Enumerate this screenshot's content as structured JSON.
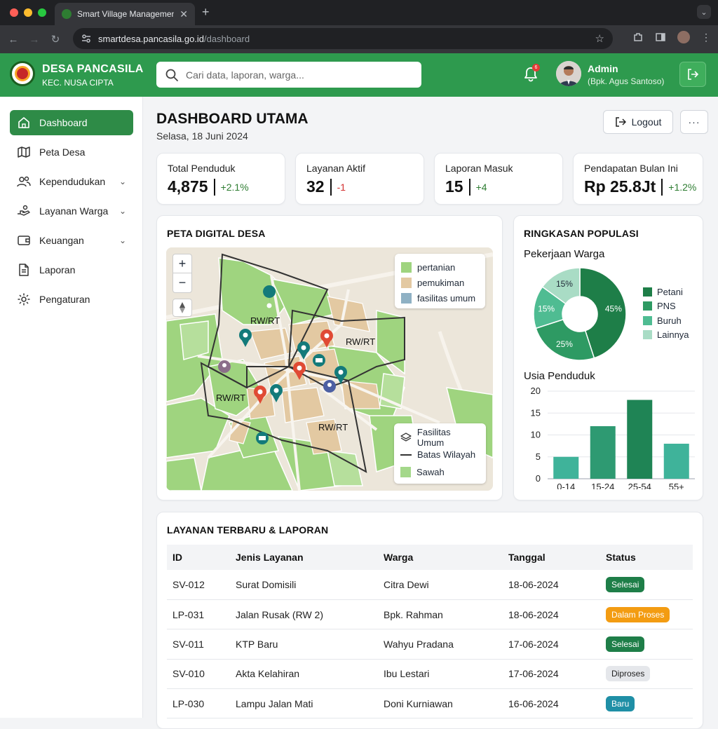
{
  "browser": {
    "tab_title": "Smart Village Management I",
    "url_host": "smartdesa.pancasila.go.id",
    "url_path": "/dashboard"
  },
  "header": {
    "brand_name": "DESA PANCASILA",
    "brand_sub": "KEC. NUSA CIPTA",
    "search_placeholder": "Cari data, laporan, warga...",
    "notif_count": "6",
    "user_name": "Admin",
    "user_role": "(Bpk. Agus Santoso)"
  },
  "sidebar": {
    "items": [
      {
        "label": "Dashboard",
        "icon": "home-icon",
        "active": true,
        "expandable": false
      },
      {
        "label": "Peta Desa",
        "icon": "map-icon",
        "active": false,
        "expandable": false
      },
      {
        "label": "Kependudukan",
        "icon": "users-icon",
        "active": false,
        "expandable": true
      },
      {
        "label": "Layanan Warga",
        "icon": "service-hand-icon",
        "active": false,
        "expandable": true
      },
      {
        "label": "Keuangan",
        "icon": "wallet-icon",
        "active": false,
        "expandable": true
      },
      {
        "label": "Laporan",
        "icon": "document-icon",
        "active": false,
        "expandable": false
      },
      {
        "label": "Pengaturan",
        "icon": "gear-icon",
        "active": false,
        "expandable": false
      }
    ]
  },
  "page": {
    "title": "DASHBOARD UTAMA",
    "date": "Selasa, 18 Juni 2024",
    "logout_label": "Logout",
    "more_label": "···"
  },
  "stats": [
    {
      "label": "Total Penduduk",
      "value": "4,875",
      "change": "+2.1%",
      "change_color": "#2e7d32"
    },
    {
      "label": "Layanan Aktif",
      "value": "32",
      "change": "-1",
      "change_color": "#d32f2f"
    },
    {
      "label": "Laporan Masuk",
      "value": "15",
      "change": "+4",
      "change_color": "#2e7d32"
    },
    {
      "label": "Pendapatan Bulan Ini",
      "value": "Rp 25.8Jt",
      "change": "+1.2%",
      "change_color": "#2e7d32"
    }
  ],
  "map": {
    "title": "PETA DIGITAL DESA",
    "zoom_in": "+",
    "zoom_out": "−",
    "legend_landuse": [
      {
        "label": "pertanian",
        "color": "#9fd47f"
      },
      {
        "label": "pemukiman",
        "color": "#e3c9a2"
      },
      {
        "label": "fasilitas umum",
        "color": "#8fb1c4"
      }
    ],
    "legend_layers": [
      {
        "label": "Fasilitas Umum",
        "icon": "layers-icon"
      },
      {
        "label": "Batas Wilayah",
        "icon": "line-icon"
      },
      {
        "label": "Sawah",
        "icon": "swatch-icon",
        "color": "#a4d88a"
      }
    ],
    "region_labels": [
      "RW/RT",
      "RW/RT",
      "RW/RT",
      "RW/RT"
    ]
  },
  "population": {
    "title": "RINGKASAN POPULASI",
    "pie_title": "Pekerjaan Warga",
    "bar_title": "Usia Penduduk"
  },
  "chart_data": [
    {
      "type": "pie",
      "title": "Pekerjaan Warga",
      "categories": [
        "Petani",
        "PNS",
        "Buruh",
        "Lainnya"
      ],
      "values": [
        45,
        25,
        15,
        15
      ],
      "labels": [
        "45%",
        "25%",
        "15%",
        "15%"
      ],
      "colors": [
        "#1e7e48",
        "#2e9a63",
        "#4fbc92",
        "#a9dcc5"
      ],
      "donut": true,
      "legend": "right"
    },
    {
      "type": "bar",
      "title": "Usia Penduduk",
      "categories": [
        "0-14",
        "15-24",
        "25-54",
        "55+"
      ],
      "values": [
        5,
        12,
        18,
        8
      ],
      "colors": [
        "#3fb39a",
        "#2e9a72",
        "#1f8455",
        "#3fb39a"
      ],
      "ylim": [
        0,
        20
      ],
      "yticks": [
        "0",
        "5",
        "10",
        "15",
        "20"
      ],
      "grid": true
    }
  ],
  "services": {
    "title": "LAYANAN TERBARU & LAPORAN",
    "columns": [
      "ID",
      "Jenis Layanan",
      "Warga",
      "Tanggal",
      "Status"
    ],
    "rows": [
      {
        "id": "SV-012",
        "type": "Surat Domisili",
        "citizen": "Citra Dewi",
        "date": "18-06-2024",
        "status": "Selesai",
        "status_bg": "#1e7e48",
        "status_fg": "#ffffff"
      },
      {
        "id": "LP-031",
        "type": "Jalan Rusak (RW 2)",
        "citizen": "Bpk. Rahman",
        "date": "18-06-2024",
        "status": "Dalam Proses",
        "status_bg": "#f39c12",
        "status_fg": "#ffffff"
      },
      {
        "id": "SV-011",
        "type": "KTP Baru",
        "citizen": "Wahyu Pradana",
        "date": "17-06-2024",
        "status": "Selesai",
        "status_bg": "#1e7e48",
        "status_fg": "#ffffff"
      },
      {
        "id": "SV-010",
        "type": "Akta Kelahiran",
        "citizen": "Ibu Lestari",
        "date": "17-06-2024",
        "status": "Diproses",
        "status_bg": "#e5e7eb",
        "status_fg": "#222222"
      },
      {
        "id": "LP-030",
        "type": "Lampu Jalan Mati",
        "citizen": "Doni Kurniawan",
        "date": "16-06-2024",
        "status": "Baru",
        "status_bg": "#1f8fa6",
        "status_fg": "#ffffff"
      }
    ]
  }
}
